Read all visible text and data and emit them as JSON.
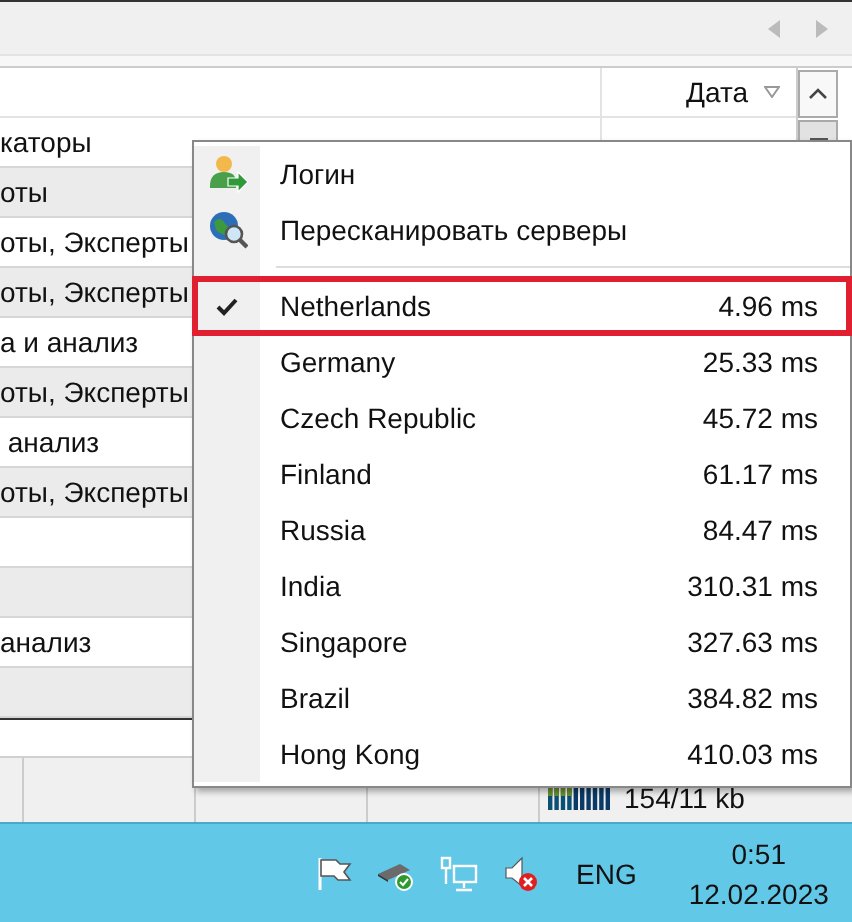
{
  "table": {
    "columns": [
      {
        "label": "Дата"
      }
    ],
    "rows": [
      {
        "kind": "text",
        "text": "каторы"
      },
      {
        "kind": "text",
        "text": "оты"
      },
      {
        "kind": "text",
        "text": "оты, Эксперты"
      },
      {
        "kind": "text",
        "text": "оты, Эксперты"
      },
      {
        "kind": "text",
        "text": "а и анализ"
      },
      {
        "kind": "text",
        "text": "оты, Эксперты"
      },
      {
        "kind": "text",
        "text": " анализ"
      },
      {
        "kind": "text",
        "text": "оты, Эксперты"
      },
      {
        "kind": "blank"
      },
      {
        "kind": "blank"
      },
      {
        "kind": "text",
        "text": "анализ"
      },
      {
        "kind": "blank"
      }
    ]
  },
  "status_bar": {
    "traffic": "154/11 kb"
  },
  "context_menu": {
    "actions": [
      {
        "label": "Логин",
        "kind": "login"
      },
      {
        "label": "Пересканировать серверы",
        "kind": "rescan"
      }
    ],
    "servers": [
      {
        "name": "Netherlands",
        "ping": "4.96 ms",
        "selected": true,
        "highlighted": true
      },
      {
        "name": "Germany",
        "ping": "25.33 ms",
        "selected": false,
        "highlighted": false
      },
      {
        "name": "Czech Republic",
        "ping": "45.72 ms",
        "selected": false,
        "highlighted": false
      },
      {
        "name": "Finland",
        "ping": "61.17 ms",
        "selected": false,
        "highlighted": false
      },
      {
        "name": "Russia",
        "ping": "84.47 ms",
        "selected": false,
        "highlighted": false
      },
      {
        "name": "India",
        "ping": "310.31 ms",
        "selected": false,
        "highlighted": false
      },
      {
        "name": "Singapore",
        "ping": "327.63 ms",
        "selected": false,
        "highlighted": false
      },
      {
        "name": "Brazil",
        "ping": "384.82 ms",
        "selected": false,
        "highlighted": false
      },
      {
        "name": "Hong Kong",
        "ping": "410.03 ms",
        "selected": false,
        "highlighted": false
      }
    ]
  },
  "taskbar": {
    "language": "ENG",
    "time": "0:51",
    "date": "12.02.2023"
  }
}
